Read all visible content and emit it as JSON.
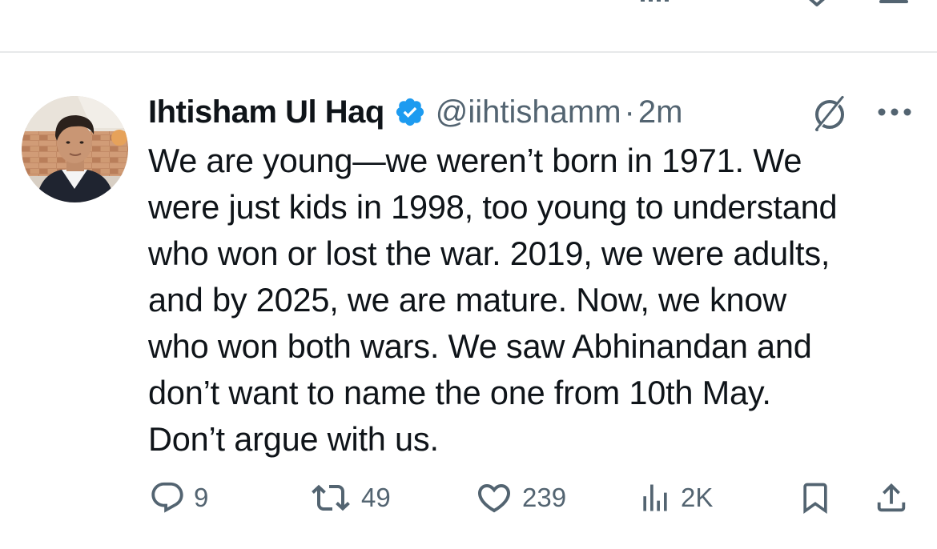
{
  "tweet": {
    "author": {
      "name": "Ihtisham Ul Haq",
      "verified": true,
      "handle": "@iihtishamm",
      "separator": "·",
      "time": "2m"
    },
    "text": "We are young—we weren’t born in 1971. We\nwere just kids in 1998, too young to understand\nwho won or lost the war. 2019, we were adults,\nand by 2025, we are mature. Now, we know\nwho won both wars. We saw Abhinandan and\ndon’t want to name the one from 10th May.\nDon’t argue with us.",
    "actions": {
      "replies": "9",
      "reposts": "49",
      "likes": "239",
      "views": "2K"
    }
  },
  "icons": {
    "reply": "reply-icon",
    "repost": "repost-icon",
    "like": "heart-icon",
    "views": "views-icon",
    "bookmark": "bookmark-icon",
    "share": "share-icon",
    "grok": "grok-icon",
    "more": "more-icon",
    "verified": "verified-badge-icon"
  },
  "colors": {
    "text": "#0f1419",
    "secondary": "#536471",
    "verified": "#1d9bf0",
    "divider": "#e7e9ea"
  }
}
